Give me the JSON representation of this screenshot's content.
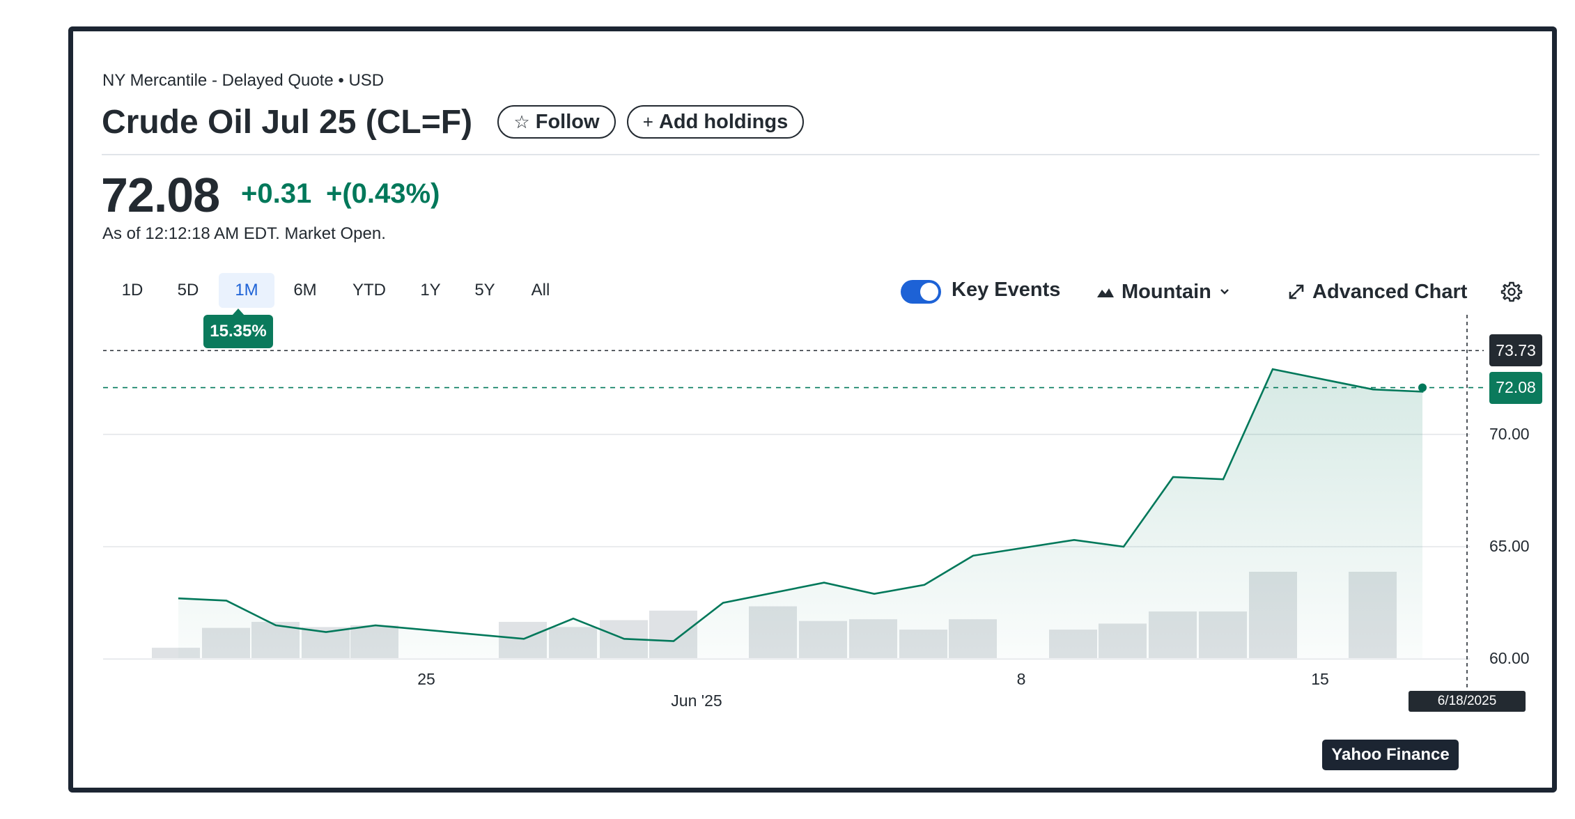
{
  "header": {
    "exchange": "NY Mercantile - Delayed Quote • USD",
    "title": "Crude Oil Jul 25 (CL=F)",
    "follow_label": "Follow",
    "add_holdings_label": "Add holdings"
  },
  "quote": {
    "price": "72.08",
    "change": "+0.31",
    "change_pct": "+(0.43%)",
    "as_of": "As of 12:12:18 AM EDT. Market Open."
  },
  "toolbar": {
    "ranges": [
      "1D",
      "5D",
      "1M",
      "6M",
      "YTD",
      "1Y",
      "5Y",
      "All"
    ],
    "active_range": "1M",
    "range_change": "15.35%",
    "key_events_label": "Key Events",
    "key_events_on": true,
    "chart_type_label": "Mountain",
    "advanced_label": "Advanced Chart"
  },
  "colors": {
    "up": "#00785a",
    "accent": "#1d62d6",
    "volume": "#dfe2e5"
  },
  "chart_data": {
    "type": "area",
    "ylim": [
      59.2,
      74.6
    ],
    "y_ticks": [
      "70.00",
      "65.00",
      "60.00"
    ],
    "x_ticks": [
      "25",
      "Jun '25",
      "8",
      "15"
    ],
    "x": [
      "2025-05-19",
      "2025-05-20",
      "2025-05-21",
      "2025-05-22",
      "2025-05-23",
      "2025-05-27",
      "2025-05-28",
      "2025-05-29",
      "2025-05-30",
      "2025-06-02",
      "2025-06-03",
      "2025-06-04",
      "2025-06-05",
      "2025-06-06",
      "2025-06-09",
      "2025-06-10",
      "2025-06-11",
      "2025-06-12",
      "2025-06-13",
      "2025-06-16",
      "2025-06-17",
      "2025-06-18"
    ],
    "series": [
      {
        "values": [
          62.7,
          62.6,
          61.5,
          61.2,
          61.5,
          60.9,
          61.8,
          60.9,
          60.8,
          62.5,
          63.4,
          62.9,
          63.3,
          64.6,
          65.3,
          65.0,
          68.1,
          68.0,
          72.9,
          72.0,
          71.9,
          72.08
        ]
      }
    ],
    "volume_relative": [
      0.12,
      0.35,
      0.42,
      0.36,
      0.38,
      0.42,
      0.36,
      0.44,
      0.55,
      0.6,
      0.43,
      0.45,
      0.33,
      0.45,
      0.33,
      0.4,
      0.54,
      0.54,
      1.0,
      1.0
    ],
    "last_price_label": "72.08",
    "cursor_price_label": "73.73",
    "cursor_date_label": "6/18/2025",
    "grid": true
  },
  "branding": {
    "label": "Yahoo Finance"
  }
}
